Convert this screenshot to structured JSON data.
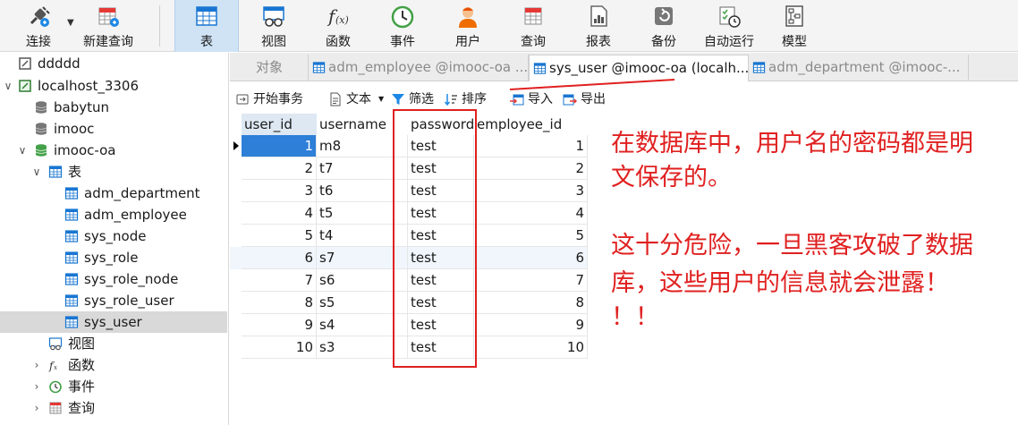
{
  "toolbar": {
    "buttons": [
      {
        "label": "连接",
        "icon": "connection-icon"
      },
      {
        "label": "新建查询",
        "icon": "new-query-icon"
      },
      {
        "label": "表",
        "icon": "table-icon",
        "active": true
      },
      {
        "label": "视图",
        "icon": "view-icon"
      },
      {
        "label": "函数",
        "icon": "function-icon"
      },
      {
        "label": "事件",
        "icon": "event-clock-icon"
      },
      {
        "label": "用户",
        "icon": "user-icon"
      },
      {
        "label": "查询",
        "icon": "query-icon"
      },
      {
        "label": "报表",
        "icon": "report-icon"
      },
      {
        "label": "备份",
        "icon": "backup-icon"
      },
      {
        "label": "自动运行",
        "icon": "automation-icon"
      },
      {
        "label": "模型",
        "icon": "model-icon"
      }
    ]
  },
  "sidebar": {
    "items": [
      {
        "label": "ddddd",
        "icon": "connection-icon"
      },
      {
        "label": "localhost_3306",
        "icon": "mysql-connection-icon",
        "expanded": true
      },
      {
        "label": "babytun",
        "icon": "database-icon"
      },
      {
        "label": "imooc",
        "icon": "database-icon"
      },
      {
        "label": "imooc-oa",
        "icon": "database-open-icon",
        "expanded": true
      },
      {
        "label": "表",
        "icon": "tables-folder-icon",
        "expanded": true
      },
      {
        "label": "adm_department",
        "icon": "table-icon"
      },
      {
        "label": "adm_employee",
        "icon": "table-icon"
      },
      {
        "label": "sys_node",
        "icon": "table-icon"
      },
      {
        "label": "sys_role",
        "icon": "table-icon"
      },
      {
        "label": "sys_role_node",
        "icon": "table-icon"
      },
      {
        "label": "sys_role_user",
        "icon": "table-icon"
      },
      {
        "label": "sys_user",
        "icon": "table-icon",
        "selected": true
      },
      {
        "label": "视图",
        "icon": "view-icon"
      },
      {
        "label": "函数",
        "icon": "function-icon"
      },
      {
        "label": "事件",
        "icon": "event-clock-icon"
      },
      {
        "label": "查询",
        "icon": "query-icon"
      }
    ]
  },
  "tabs": [
    {
      "label": "对象"
    },
    {
      "label": "adm_employee @imooc-oa ..."
    },
    {
      "label": "sys_user @imooc-oa (localh...",
      "active": true
    },
    {
      "label": "adm_department @imooc-..."
    }
  ],
  "subtoolbar": {
    "begin_transaction": "开始事务",
    "text": "文本",
    "filter": "筛选",
    "sort": "排序",
    "import": "导入",
    "export": "导出"
  },
  "grid": {
    "columns": [
      "user_id",
      "username",
      "password",
      "employee_id"
    ],
    "rows": [
      [
        "1",
        "m8",
        "test",
        "1"
      ],
      [
        "2",
        "t7",
        "test",
        "2"
      ],
      [
        "3",
        "t6",
        "test",
        "3"
      ],
      [
        "4",
        "t5",
        "test",
        "4"
      ],
      [
        "5",
        "t4",
        "test",
        "5"
      ],
      [
        "6",
        "s7",
        "test",
        "6"
      ],
      [
        "7",
        "s6",
        "test",
        "7"
      ],
      [
        "8",
        "s5",
        "test",
        "8"
      ],
      [
        "9",
        "s4",
        "test",
        "9"
      ],
      [
        "10",
        "s3",
        "test",
        "10"
      ]
    ]
  },
  "annotation": {
    "lines": [
      "在数据库中，用户名的密码都是明",
      "文保存的。",
      "这十分危险，一旦黑客攻破了数据",
      "库，这些用户的信息就会泄露！",
      "！！"
    ],
    "color": "#e02020"
  }
}
